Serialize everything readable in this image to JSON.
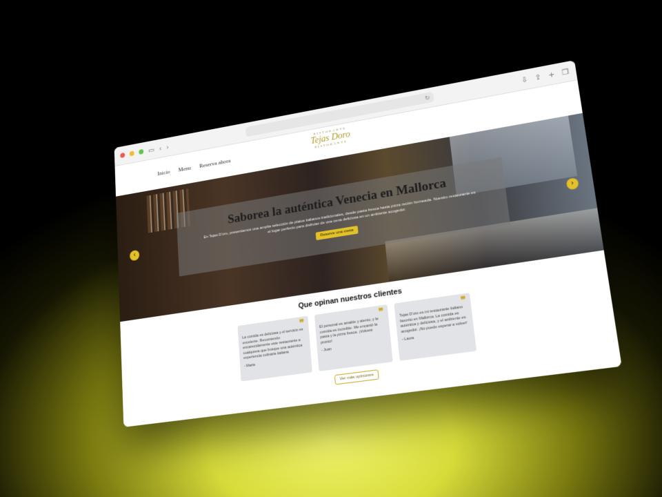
{
  "nav": {
    "items": [
      "Inicio",
      "Menu",
      "Reserva ahora"
    ]
  },
  "logo": {
    "top": "RISTORANTE",
    "name": "Tejas Doro",
    "bottom": "RISTORANTE"
  },
  "hero": {
    "title": "Saborea la auténtica Venecia en Mallorca",
    "text": "En Tejas D'oro, presentamos una amplia selección de platos italianos tradicionales, desde pasta fresca hasta pizza recién horneada. Nuestro restaurante es el lugar perfecto para disfrutar de una cena deliciosa en un ambiente acogedor.",
    "button": "Reserve una mesa"
  },
  "testimonials": {
    "title": "Que opinan nuestros clientes",
    "items": [
      {
        "text": "La comida es deliciosa y el servicio es excelente. Recomiendo encarecidamente este restaurante a cualquiera que busque una auténtica experiencia culinaria italiana.",
        "author": "- Maria"
      },
      {
        "text": "El personal es amable y atento, y la comida es increíble. Me encantó la pasta y la pizza fresca. ¡Volveré pronto!",
        "author": "- Juan"
      },
      {
        "text": "Tejas D'oro es mi restaurante italiano favorito en Mallorca. La comida es auténtica y deliciosa, y el ambiente es acogedor. ¡No puedo esperar a volver!",
        "author": "- Laura"
      }
    ],
    "more_button": "Ver más opiniones"
  },
  "colors": {
    "accent": "#e2c12a"
  }
}
